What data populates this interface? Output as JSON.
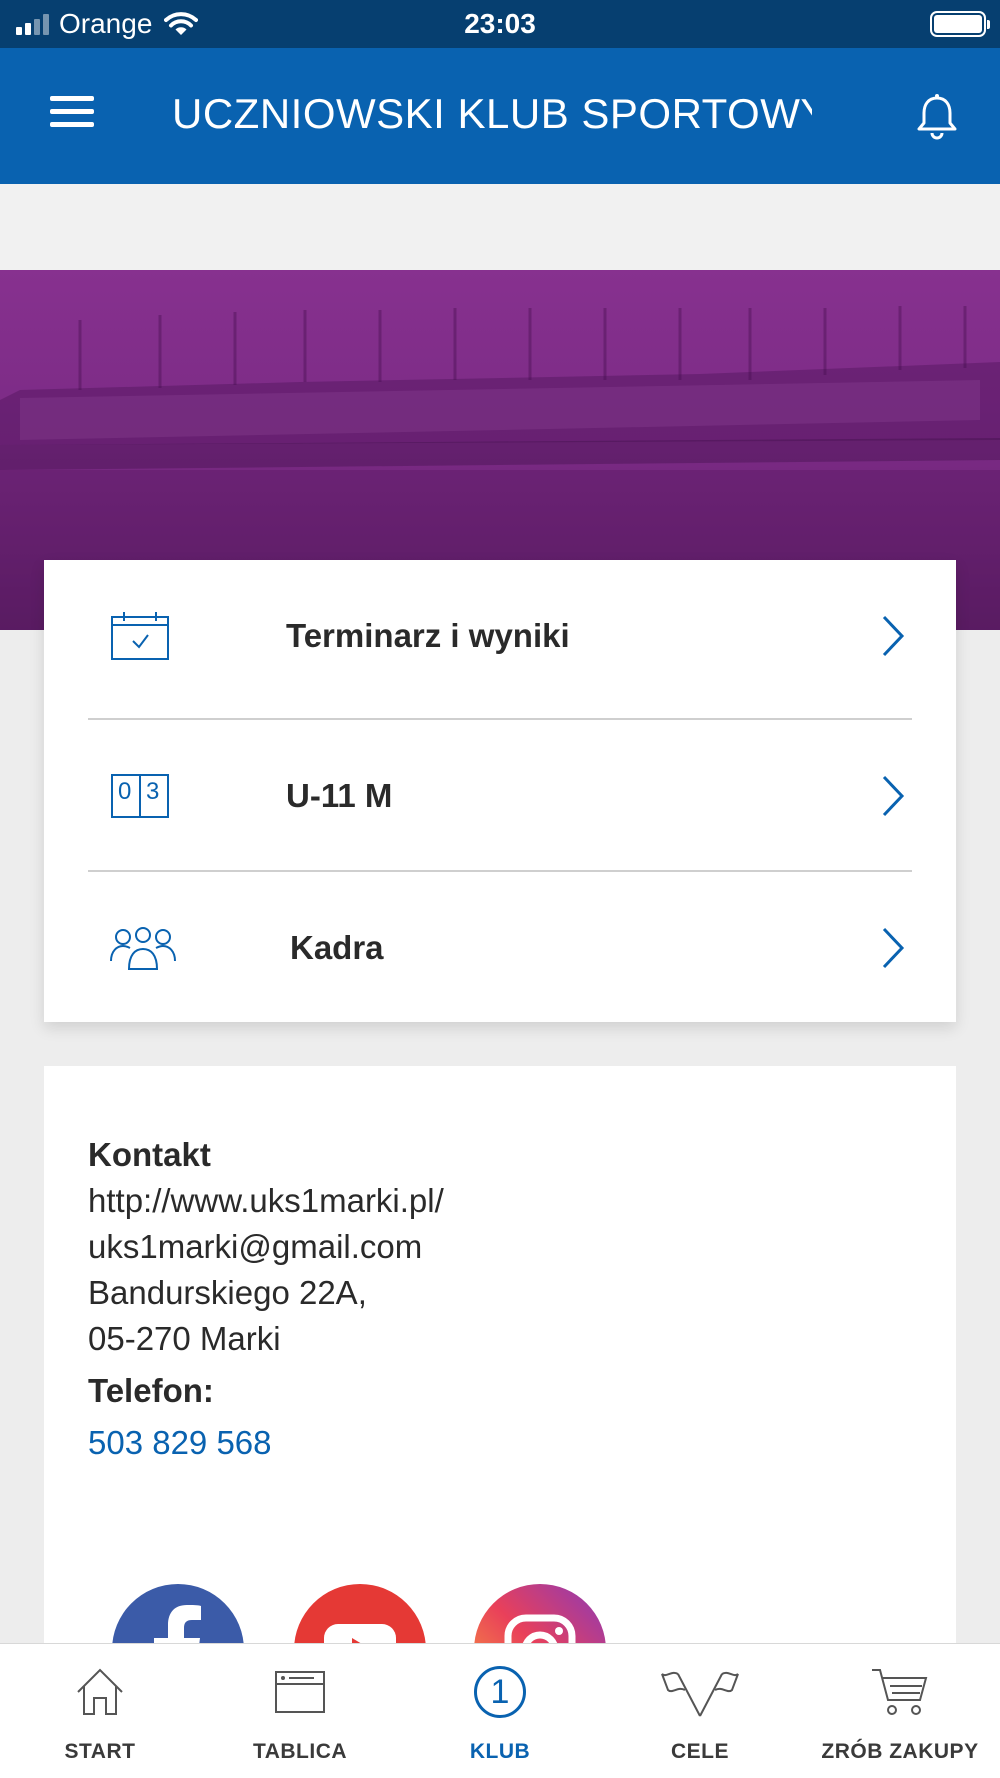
{
  "status_bar": {
    "carrier": "Orange",
    "time": "23:03"
  },
  "header": {
    "title": "UCZNIOWSKI KLUB SPORTOWY…"
  },
  "menu": [
    {
      "label": "Terminarz i wyniki",
      "icon": "calendar-icon"
    },
    {
      "label": "U-11 M",
      "icon": "scoreboard-icon",
      "icon_digits": [
        "0",
        "3"
      ]
    },
    {
      "label": "Kadra",
      "icon": "team-icon"
    }
  ],
  "contact": {
    "heading": "Kontakt",
    "website": "http://www.uks1marki.pl/",
    "email": "uks1marki@gmail.com",
    "address_line1": "Bandurskiego 22A,",
    "address_line2": "05-270 Marki",
    "phone_label": "Telefon:",
    "phone": "503 829 568"
  },
  "socials": [
    "facebook-icon",
    "youtube-icon",
    "instagram-icon"
  ],
  "bottom_nav": [
    {
      "label": "START",
      "icon": "home-icon"
    },
    {
      "label": "TABLICA",
      "icon": "board-icon"
    },
    {
      "label": "KLUB",
      "icon": "club-icon",
      "active": true,
      "icon_text": "1"
    },
    {
      "label": "CELE",
      "icon": "flags-icon"
    },
    {
      "label": "ZRÓB ZAKUPY",
      "icon": "cart-icon"
    }
  ],
  "colors": {
    "header": "#0962b0",
    "status_bar": "#063f70",
    "hero": "#7a2a84",
    "accent": "#0962b0"
  }
}
